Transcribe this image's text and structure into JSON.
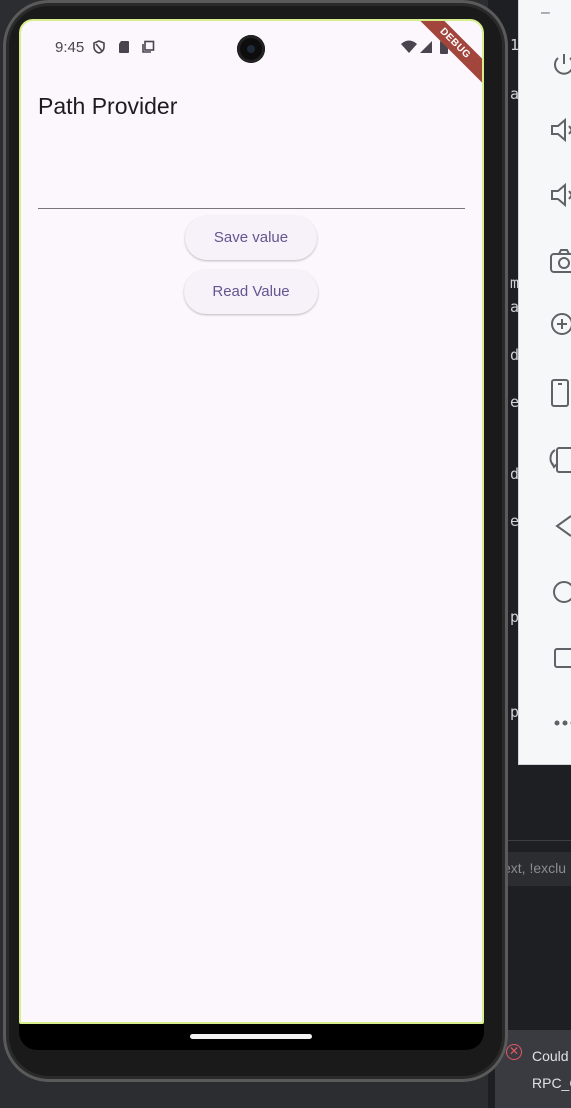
{
  "ide": {
    "side_letters": [
      "1",
      "a",
      "m",
      "a",
      "d",
      "e",
      "d",
      "e",
      "p",
      "p"
    ],
    "filter_text": "ext, !exclu",
    "notice_line1": "Could",
    "notice_line2": "RPC_C"
  },
  "emulator_toolbar": {
    "minimize_label": "–",
    "buttons": [
      "power-icon",
      "volume-up-icon",
      "volume-down-icon",
      "camera-icon",
      "zoom-in-icon",
      "rotate-left-icon",
      "rotate-right-icon",
      "back-icon",
      "home-icon",
      "overview-icon",
      "more-icon"
    ]
  },
  "status_bar": {
    "time": "9:45"
  },
  "debug_banner": "DEBUG",
  "app": {
    "title": "Path Provider",
    "text_field_value": "",
    "save_button_label": "Save value",
    "read_button_label": "Read Value"
  }
}
